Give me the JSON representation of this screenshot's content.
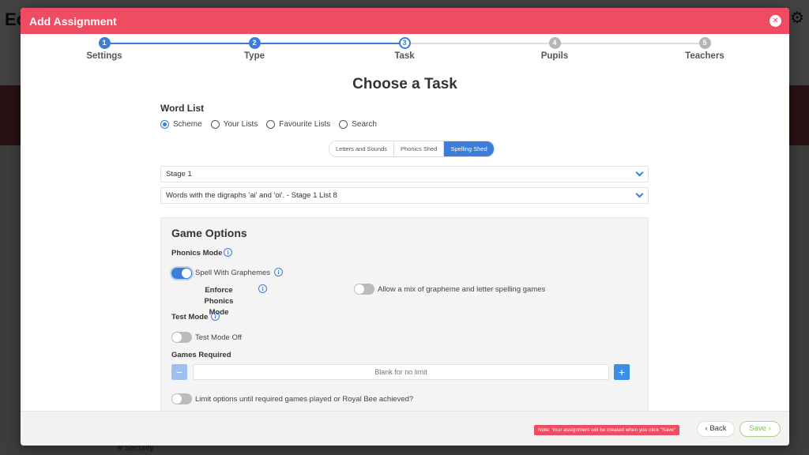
{
  "background": {
    "logo_text": "Ec",
    "security_text": "Security"
  },
  "modal": {
    "title": "Add Assignment",
    "close_icon": "close-icon"
  },
  "steps": [
    {
      "number": "1",
      "label": "Settings",
      "state": "complete"
    },
    {
      "number": "2",
      "label": "Type",
      "state": "complete"
    },
    {
      "number": "3",
      "label": "Task",
      "state": "current"
    },
    {
      "number": "4",
      "label": "Pupils",
      "state": "pending"
    },
    {
      "number": "5",
      "label": "Teachers",
      "state": "pending"
    }
  ],
  "page_title": "Choose a Task",
  "word_list": {
    "label": "Word List",
    "radios": [
      {
        "label": "Scheme",
        "selected": true
      },
      {
        "label": "Your Lists",
        "selected": false
      },
      {
        "label": "Favourite Lists",
        "selected": false
      },
      {
        "label": "Search",
        "selected": false
      }
    ],
    "schemes": [
      {
        "label": "Letters and Sounds",
        "active": false
      },
      {
        "label": "Phonics Shed",
        "active": false
      },
      {
        "label": "Spelling Shed",
        "active": true
      }
    ],
    "stage_select": "Stage 1",
    "list_select": "Words with the digraphs 'ai' and 'oi'. - Stage 1 List 8"
  },
  "game_options": {
    "title": "Game Options",
    "phonics_mode_label": "Phonics Mode",
    "spell_graphemes_label": "Spell With Graphemes",
    "spell_graphemes_on": true,
    "enforce_line1": "Enforce Phonics",
    "enforce_line2": "Mode",
    "mix_label": "Allow a mix of grapheme and letter spelling games",
    "mix_on": false,
    "test_mode_label": "Test Mode",
    "test_mode_toggle_label": "Test Mode Off",
    "test_mode_on": false,
    "games_required_label": "Games Required",
    "games_required_placeholder": "Blank for no limit",
    "minus_label": "−",
    "plus_label": "+",
    "limit_label": "Limit options until required games played or Royal Bee achieved?",
    "limit_on": false
  },
  "footer": {
    "note": "Note: Your assignment will be created when you click \"Save\"",
    "back_label": "Back",
    "back_icon": "chevron-left-icon",
    "save_label": "Save",
    "save_icon": "chevron-right-icon"
  },
  "colors": {
    "header": "#ef4b62",
    "accent": "#3b7dd8",
    "step_pending": "#b5b5b5",
    "minus_btn": "#9cc1ee",
    "plus_btn": "#3b8fe6",
    "save_green": "#7cc04a"
  }
}
